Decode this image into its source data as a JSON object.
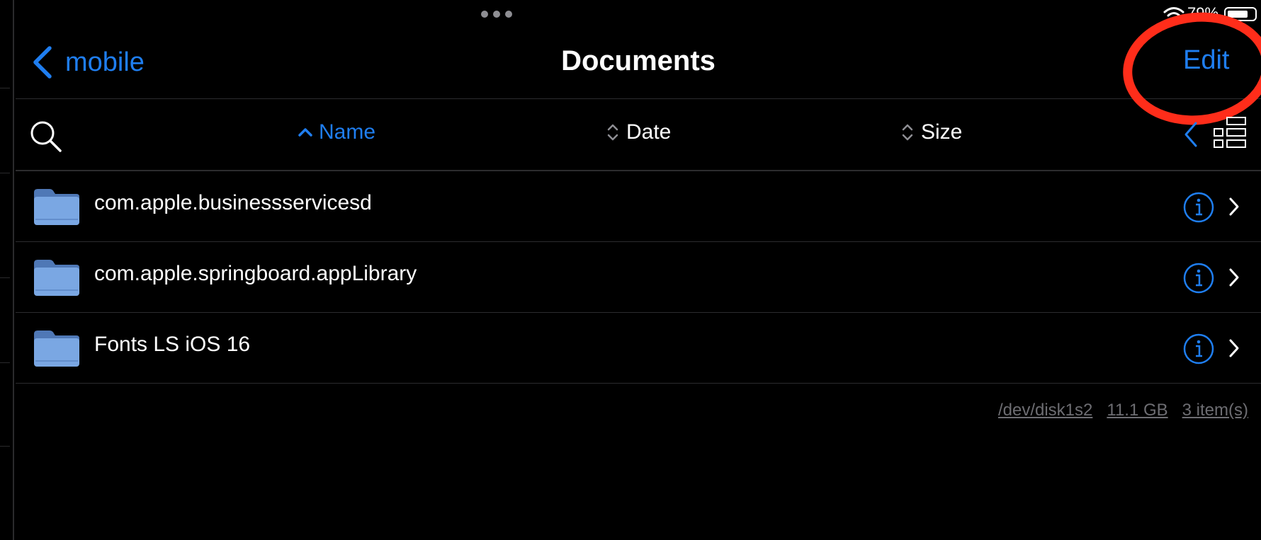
{
  "status_bar": {
    "battery_text": "79%",
    "wifi_icon": "wifi-icon",
    "battery_icon": "battery-icon"
  },
  "nav": {
    "back_label": "mobile",
    "title": "Documents",
    "edit_label": "Edit"
  },
  "sort_bar": {
    "columns": [
      {
        "label": "Name",
        "active": true
      },
      {
        "label": "Date",
        "active": false
      },
      {
        "label": "Size",
        "active": false
      }
    ]
  },
  "files": [
    {
      "name": "com.apple.businessservicesd",
      "type": "folder"
    },
    {
      "name": "com.apple.springboard.appLibrary",
      "type": "folder"
    },
    {
      "name": "Fonts LS iOS 16",
      "type": "folder"
    }
  ],
  "footer": {
    "disk": "/dev/disk1s2",
    "free_space": "11.1 GB",
    "item_count": "3 item(s)"
  },
  "colors": {
    "accent": "#1f7ef0",
    "annotation": "#ff2d1a",
    "folder": "#7aa7e3",
    "background": "#000000"
  }
}
